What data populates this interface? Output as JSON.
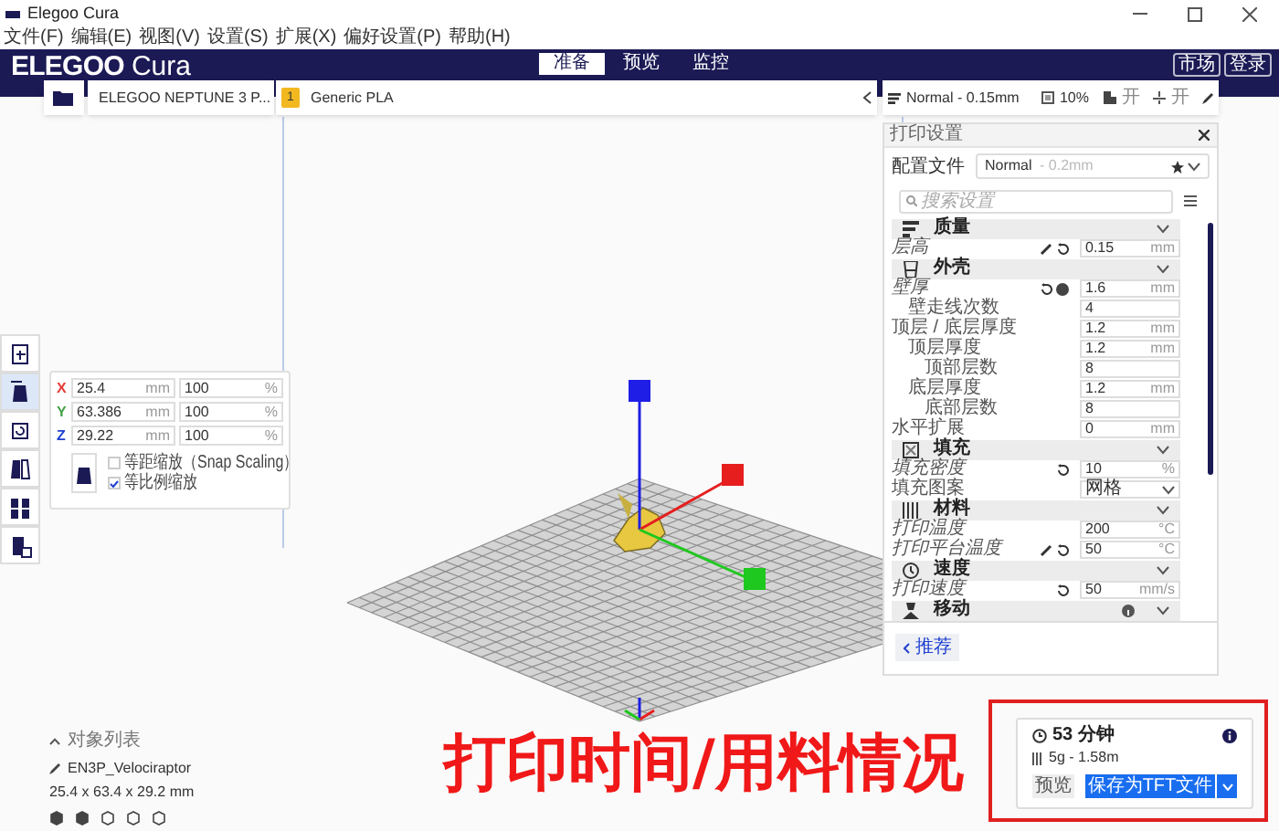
{
  "window": {
    "title": "Elegoo Cura"
  },
  "menu": [
    "文件(F)",
    "编辑(E)",
    "视图(V)",
    "设置(S)",
    "扩展(X)",
    "偏好设置(P)",
    "帮助(H)"
  ],
  "header": {
    "logo_brand": "ELEGOO",
    "logo_product": "Cura",
    "stages": [
      {
        "label": "准备",
        "selected": true
      },
      {
        "label": "预览",
        "selected": false
      },
      {
        "label": "监控",
        "selected": false
      }
    ],
    "buttons": [
      "市场",
      "登录"
    ]
  },
  "toolbar": {
    "printer": "ELEGOO NEPTUNE 3 P...",
    "material_badge": "1",
    "material": "Generic PLA",
    "profile": "Normal - 0.15mm",
    "infill": "10%",
    "support": "开",
    "adhesion": "开"
  },
  "tools": [
    {
      "kind": "move",
      "selected": false
    },
    {
      "kind": "scale",
      "selected": true
    },
    {
      "kind": "rotate",
      "selected": false
    },
    {
      "kind": "mirror",
      "selected": false
    },
    {
      "kind": "per-model",
      "selected": false
    },
    {
      "kind": "blocker",
      "selected": false
    }
  ],
  "scale_panel": {
    "axes": [
      {
        "axis": "X",
        "color": "#e53935",
        "value": "25.4",
        "unit": "mm",
        "percent": "100",
        "percent_unit": "%"
      },
      {
        "axis": "Y",
        "color": "#43a047",
        "value": "63.386",
        "unit": "mm",
        "percent": "100",
        "percent_unit": "%"
      },
      {
        "axis": "Z",
        "color": "#1e3fd0",
        "value": "29.22",
        "unit": "mm",
        "percent": "100",
        "percent_unit": "%"
      }
    ],
    "options": [
      {
        "label": "等距缩放（Snap Scaling）",
        "checked": false
      },
      {
        "label": "等比例缩放",
        "checked": true
      }
    ]
  },
  "print_settings": {
    "title": "打印设置",
    "profile_label": "配置文件",
    "profile_name": "Normal",
    "profile_detail": " - 0.2mm",
    "search_placeholder": "搜索设置",
    "footer_button": "推荐",
    "rows": [
      {
        "kind": "category",
        "label": "质量",
        "children": [
          {
            "kind": "field",
            "label": "层高",
            "value": "0.15",
            "unit": "mm",
            "modified": true,
            "linked": true,
            "reset": true
          }
        ]
      },
      {
        "kind": "category",
        "label": "外壳",
        "children": [
          {
            "kind": "field",
            "label": "壁厚",
            "value": "1.6",
            "unit": "mm",
            "modified": true,
            "reset": true,
            "warning": true,
            "children": [
              {
                "kind": "field",
                "label": "壁走线次数",
                "value": "4",
                "modified": false
              }
            ]
          },
          {
            "kind": "field",
            "label": "顶层 / 底层厚度",
            "value": "1.2",
            "unit": "mm",
            "modified": false,
            "children": [
              {
                "kind": "field",
                "label": "顶层厚度",
                "value": "1.2",
                "unit": "mm",
                "modified": false,
                "children": [
                  {
                    "kind": "field",
                    "label": "顶部层数",
                    "value": "8",
                    "modified": false
                  }
                ]
              },
              {
                "kind": "field",
                "label": "底层厚度",
                "value": "1.2",
                "unit": "mm",
                "modified": false,
                "children": [
                  {
                    "kind": "field",
                    "label": "底部层数",
                    "value": "8",
                    "modified": false
                  }
                ]
              }
            ]
          },
          {
            "kind": "field",
            "label": "水平扩展",
            "value": "0",
            "unit": "mm",
            "modified": false
          }
        ]
      },
      {
        "kind": "category",
        "label": "填充",
        "children": [
          {
            "kind": "field",
            "label": "填充密度",
            "value": "10",
            "unit": "%",
            "modified": true,
            "reset": true
          },
          {
            "kind": "dropdown",
            "label": "填充图案",
            "value": "网格",
            "modified": false
          }
        ]
      },
      {
        "kind": "category",
        "label": "材料",
        "children": [
          {
            "kind": "field",
            "label": "打印温度",
            "value": "200",
            "unit": "°C",
            "modified": true
          },
          {
            "kind": "field",
            "label": "打印平台温度",
            "value": "50",
            "unit": "°C",
            "modified": true,
            "linked": true,
            "reset": true
          }
        ]
      },
      {
        "kind": "category",
        "label": "速度",
        "children": [
          {
            "kind": "field",
            "label": "打印速度",
            "value": "50",
            "unit": "mm/s",
            "modified": true,
            "reset": true
          }
        ]
      },
      {
        "kind": "category",
        "label": "移动",
        "info": true
      }
    ]
  },
  "object_list": {
    "title": "对象列表",
    "name": "EN3P_Velociraptor",
    "dimensions": "25.4 x 63.4 x 29.2 mm"
  },
  "annotation": "打印时间/用料情况",
  "estimate": {
    "time": "53 分钟",
    "material": "5g - 1.58m",
    "preview_button": "预览",
    "save_button": "保存为TFT文件"
  }
}
